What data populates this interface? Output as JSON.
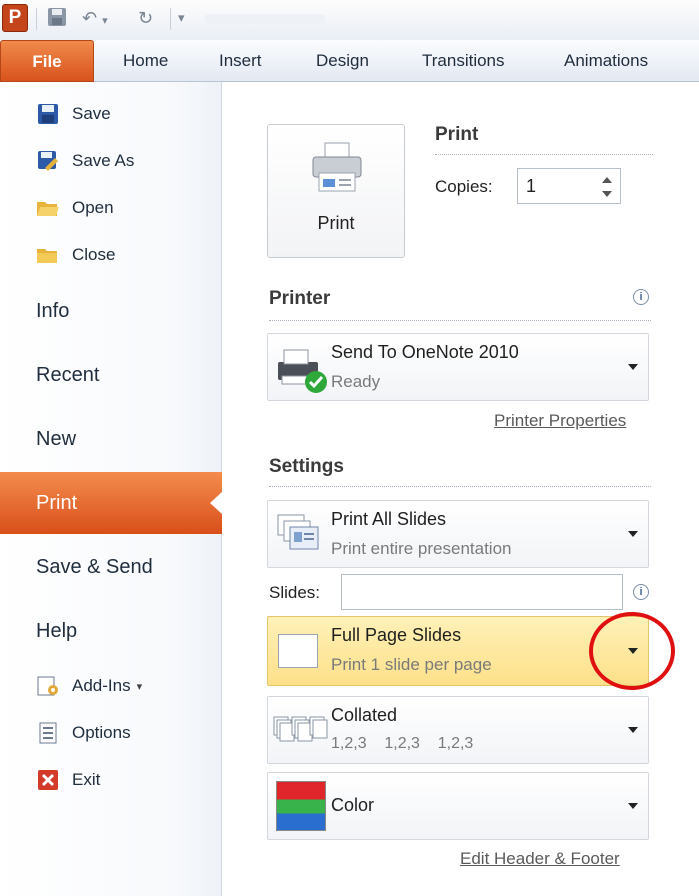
{
  "app": {
    "logo_letter": "P"
  },
  "tabs": [
    {
      "label": "File"
    },
    {
      "label": "Home"
    },
    {
      "label": "Insert"
    },
    {
      "label": "Design"
    },
    {
      "label": "Transitions"
    },
    {
      "label": "Animations"
    }
  ],
  "backstage": {
    "small_top": [
      {
        "label": "Save",
        "icon": "save-icon"
      },
      {
        "label": "Save As",
        "icon": "save-as-icon"
      },
      {
        "label": "Open",
        "icon": "open-folder-icon"
      },
      {
        "label": "Close",
        "icon": "close-folder-icon"
      }
    ],
    "big": [
      {
        "label": "Info"
      },
      {
        "label": "Recent"
      },
      {
        "label": "New"
      },
      {
        "label": "Print"
      },
      {
        "label": "Save & Send"
      },
      {
        "label": "Help"
      }
    ],
    "small_bottom": [
      {
        "label": "Add-Ins",
        "suffix": "▾",
        "icon": "add-ins-icon"
      },
      {
        "label": "Options",
        "icon": "options-icon"
      },
      {
        "label": "Exit",
        "icon": "exit-icon"
      }
    ]
  },
  "print": {
    "section_title": "Print",
    "button_label": "Print",
    "copies_label": "Copies:",
    "copies_value": "1"
  },
  "printer": {
    "section_title": "Printer",
    "name": "Send To OneNote 2010",
    "status": "Ready",
    "properties_link": "Printer Properties"
  },
  "settings": {
    "section_title": "Settings",
    "range": {
      "title": "Print All Slides",
      "subtitle": "Print entire presentation"
    },
    "slides_label": "Slides:",
    "slides_value": "",
    "layout": {
      "title": "Full Page Slides",
      "subtitle": "Print 1 slide per page"
    },
    "collation": {
      "title": "Collated",
      "subtitle": "1,2,3    1,2,3    1,2,3"
    },
    "color": {
      "title": "Color"
    },
    "edit_header_link": "Edit Header & Footer"
  },
  "colors": {
    "accent": "#d9531d",
    "highlight": "#fde79a",
    "annotation": "#e01010"
  }
}
